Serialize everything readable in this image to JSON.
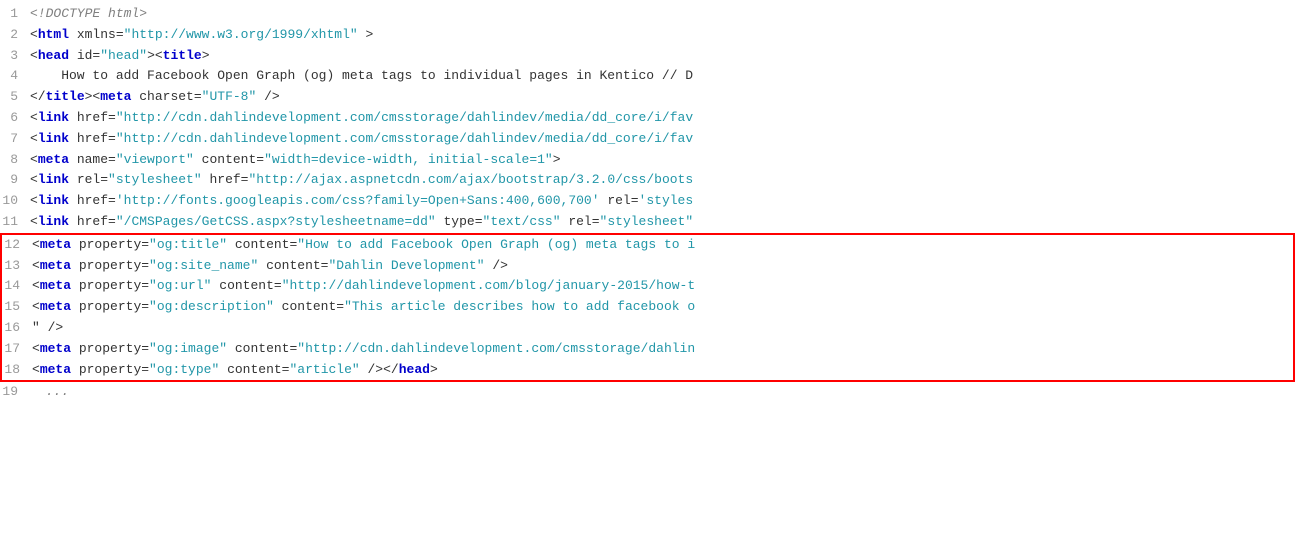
{
  "lines": [
    {
      "num": 1,
      "highlighted": false,
      "parts": [
        {
          "text": "<!DOCTYPE html>",
          "class": "comment"
        }
      ]
    },
    {
      "num": 2,
      "highlighted": false,
      "parts": [
        {
          "text": "<",
          "class": "plain"
        },
        {
          "text": "html",
          "class": "tag"
        },
        {
          "text": " xmlns=",
          "class": "plain"
        },
        {
          "text": "\"http://www.w3.org/1999/xhtml\"",
          "class": "string-blue"
        },
        {
          "text": " >",
          "class": "plain"
        }
      ]
    },
    {
      "num": 3,
      "highlighted": false,
      "parts": [
        {
          "text": "<",
          "class": "plain"
        },
        {
          "text": "head",
          "class": "tag"
        },
        {
          "text": " id=",
          "class": "plain"
        },
        {
          "text": "\"head\"",
          "class": "string-blue"
        },
        {
          "text": "><",
          "class": "plain"
        },
        {
          "text": "title",
          "class": "tag"
        },
        {
          "text": ">",
          "class": "plain"
        }
      ]
    },
    {
      "num": 4,
      "highlighted": false,
      "parts": [
        {
          "text": "    How to add Facebook Open Graph (og) meta tags to individual pages in Kentico // D",
          "class": "plain"
        }
      ]
    },
    {
      "num": 5,
      "highlighted": false,
      "parts": [
        {
          "text": "</",
          "class": "plain"
        },
        {
          "text": "title",
          "class": "tag"
        },
        {
          "text": "><",
          "class": "plain"
        },
        {
          "text": "meta",
          "class": "tag"
        },
        {
          "text": " charset=",
          "class": "plain"
        },
        {
          "text": "\"UTF-8\"",
          "class": "string-blue"
        },
        {
          "text": " />",
          "class": "plain"
        }
      ]
    },
    {
      "num": 6,
      "highlighted": false,
      "parts": [
        {
          "text": "<",
          "class": "plain"
        },
        {
          "text": "link",
          "class": "tag"
        },
        {
          "text": " href=",
          "class": "plain"
        },
        {
          "text": "\"http://cdn.dahlindevelopment.com/cmsstorage/dahlindev/media/dd_core/i/fav",
          "class": "string-blue"
        }
      ]
    },
    {
      "num": 7,
      "highlighted": false,
      "parts": [
        {
          "text": "<",
          "class": "plain"
        },
        {
          "text": "link",
          "class": "tag"
        },
        {
          "text": " href=",
          "class": "plain"
        },
        {
          "text": "\"http://cdn.dahlindevelopment.com/cmsstorage/dahlindev/media/dd_core/i/fav",
          "class": "string-blue"
        }
      ]
    },
    {
      "num": 8,
      "highlighted": false,
      "parts": [
        {
          "text": "<",
          "class": "plain"
        },
        {
          "text": "meta",
          "class": "tag"
        },
        {
          "text": " name=",
          "class": "plain"
        },
        {
          "text": "\"viewport\"",
          "class": "string-blue"
        },
        {
          "text": " content=",
          "class": "plain"
        },
        {
          "text": "\"width=device-width, initial-scale=1\"",
          "class": "string-blue"
        },
        {
          "text": ">",
          "class": "plain"
        }
      ]
    },
    {
      "num": 9,
      "highlighted": false,
      "parts": [
        {
          "text": "<",
          "class": "plain"
        },
        {
          "text": "link",
          "class": "tag"
        },
        {
          "text": " rel=",
          "class": "plain"
        },
        {
          "text": "\"stylesheet\"",
          "class": "string-blue"
        },
        {
          "text": " href=",
          "class": "plain"
        },
        {
          "text": "\"http://ajax.aspnetcdn.com/ajax/bootstrap/3.2.0/css/boots",
          "class": "string-blue"
        }
      ]
    },
    {
      "num": 10,
      "highlighted": false,
      "parts": [
        {
          "text": "<",
          "class": "plain"
        },
        {
          "text": "link",
          "class": "tag"
        },
        {
          "text": " href=",
          "class": "plain"
        },
        {
          "text": "'http://fonts.googleapis.com/css?family=Open+Sans:400,600,700'",
          "class": "string-blue"
        },
        {
          "text": " rel=",
          "class": "plain"
        },
        {
          "text": "'styles",
          "class": "string-blue"
        }
      ]
    },
    {
      "num": 11,
      "highlighted": false,
      "parts": [
        {
          "text": "<",
          "class": "plain"
        },
        {
          "text": "link",
          "class": "tag"
        },
        {
          "text": " href=",
          "class": "plain"
        },
        {
          "text": "\"/CMSPages/GetCSS.aspx?stylesheetname=dd\"",
          "class": "string-blue"
        },
        {
          "text": " type=",
          "class": "plain"
        },
        {
          "text": "\"text/css\"",
          "class": "string-blue"
        },
        {
          "text": " rel=",
          "class": "plain"
        },
        {
          "text": "\"stylesheet\"",
          "class": "string-blue"
        }
      ]
    },
    {
      "num": 12,
      "highlighted": true,
      "parts": [
        {
          "text": "<",
          "class": "plain"
        },
        {
          "text": "meta",
          "class": "tag"
        },
        {
          "text": " property=",
          "class": "plain"
        },
        {
          "text": "\"og:title\"",
          "class": "string-blue"
        },
        {
          "text": " content=",
          "class": "plain"
        },
        {
          "text": "\"How to add Facebook Open Graph (og) meta tags to i",
          "class": "string-blue"
        }
      ]
    },
    {
      "num": 13,
      "highlighted": true,
      "parts": [
        {
          "text": "<",
          "class": "plain"
        },
        {
          "text": "meta",
          "class": "tag"
        },
        {
          "text": " property=",
          "class": "plain"
        },
        {
          "text": "\"og:site_name\"",
          "class": "string-blue"
        },
        {
          "text": " content=",
          "class": "plain"
        },
        {
          "text": "\"Dahlin Development\"",
          "class": "string-blue"
        },
        {
          "text": " />",
          "class": "plain"
        }
      ]
    },
    {
      "num": 14,
      "highlighted": true,
      "parts": [
        {
          "text": "<",
          "class": "plain"
        },
        {
          "text": "meta",
          "class": "tag"
        },
        {
          "text": " property=",
          "class": "plain"
        },
        {
          "text": "\"og:url\"",
          "class": "string-blue"
        },
        {
          "text": " content=",
          "class": "plain"
        },
        {
          "text": "\"http://dahlindevelopment.com/blog/january-2015/how-t",
          "class": "string-blue"
        }
      ]
    },
    {
      "num": 15,
      "highlighted": true,
      "parts": [
        {
          "text": "<",
          "class": "plain"
        },
        {
          "text": "meta",
          "class": "tag"
        },
        {
          "text": " property=",
          "class": "plain"
        },
        {
          "text": "\"og:description\"",
          "class": "string-blue"
        },
        {
          "text": " content=",
          "class": "plain"
        },
        {
          "text": "\"This article describes how to add facebook o",
          "class": "string-blue"
        }
      ]
    },
    {
      "num": 16,
      "highlighted": true,
      "parts": [
        {
          "text": "\" />",
          "class": "plain"
        }
      ]
    },
    {
      "num": 17,
      "highlighted": true,
      "parts": [
        {
          "text": "<",
          "class": "plain"
        },
        {
          "text": "meta",
          "class": "tag"
        },
        {
          "text": " property=",
          "class": "plain"
        },
        {
          "text": "\"og:image\"",
          "class": "string-blue"
        },
        {
          "text": " content=",
          "class": "plain"
        },
        {
          "text": "\"http://cdn.dahlindevelopment.com/cmsstorage/dahlin",
          "class": "string-blue"
        }
      ]
    },
    {
      "num": 18,
      "highlighted": true,
      "parts": [
        {
          "text": "<",
          "class": "plain"
        },
        {
          "text": "meta",
          "class": "tag"
        },
        {
          "text": " property=",
          "class": "plain"
        },
        {
          "text": "\"og:type\"",
          "class": "string-blue"
        },
        {
          "text": " content=",
          "class": "plain"
        },
        {
          "text": "\"article\"",
          "class": "string-blue"
        },
        {
          "text": " /></",
          "class": "plain"
        },
        {
          "text": "head",
          "class": "tag"
        },
        {
          "text": ">",
          "class": "plain"
        }
      ]
    },
    {
      "num": 19,
      "highlighted": false,
      "parts": [
        {
          "text": "  ...",
          "class": "comment"
        }
      ]
    }
  ]
}
